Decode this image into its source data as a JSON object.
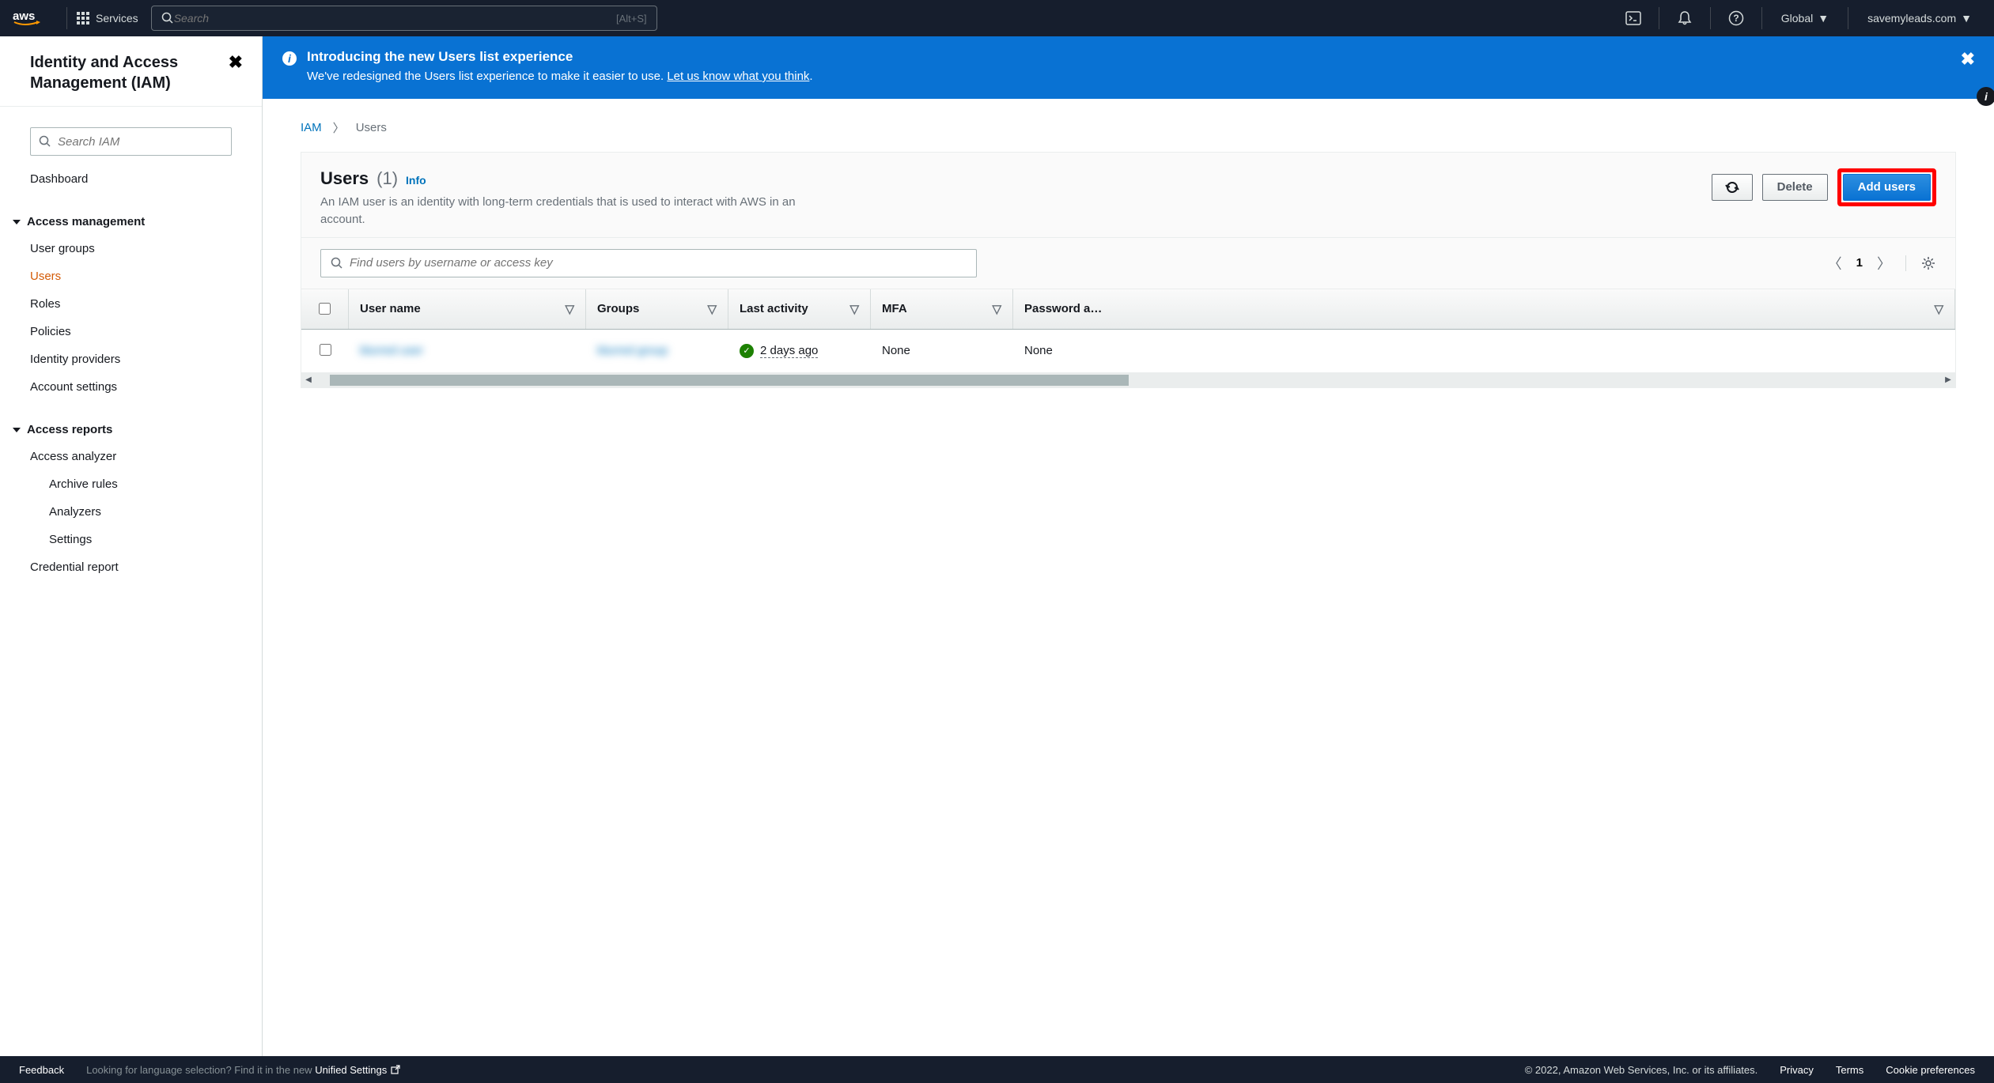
{
  "topnav": {
    "services_label": "Services",
    "search_placeholder": "Search",
    "search_shortcut": "[Alt+S]",
    "region": "Global",
    "account": "savemyleads.com"
  },
  "sidebar": {
    "title": "Identity and Access Management (IAM)",
    "search_placeholder": "Search IAM",
    "dashboard": "Dashboard",
    "section_access_mgmt": "Access management",
    "items_access": [
      "User groups",
      "Users",
      "Roles",
      "Policies",
      "Identity providers",
      "Account settings"
    ],
    "section_reports": "Access reports",
    "access_analyzer": "Access analyzer",
    "analyzer_sub": [
      "Archive rules",
      "Analyzers",
      "Settings"
    ],
    "credential_report": "Credential report"
  },
  "banner": {
    "title": "Introducing the new Users list experience",
    "text": "We've redesigned the Users list experience to make it easier to use. ",
    "link": "Let us know what you think"
  },
  "breadcrumb": {
    "root": "IAM",
    "current": "Users"
  },
  "panel": {
    "title": "Users",
    "count": "(1)",
    "info": "Info",
    "description": "An IAM user is an identity with long-term credentials that is used to interact with AWS in an account.",
    "btn_delete": "Delete",
    "btn_add": "Add users",
    "search_placeholder": "Find users by username or access key",
    "page": "1"
  },
  "table": {
    "columns": {
      "user": "User name",
      "groups": "Groups",
      "activity": "Last activity",
      "mfa": "MFA",
      "password": "Password a…"
    },
    "rows": [
      {
        "user": "blurred user",
        "groups": "blurred group",
        "activity": "2 days ago",
        "mfa": "None",
        "password": "None"
      }
    ]
  },
  "footer": {
    "feedback": "Feedback",
    "lang_text": "Looking for language selection? Find it in the new ",
    "unified": "Unified Settings",
    "copyright": "© 2022, Amazon Web Services, Inc. or its affiliates.",
    "privacy": "Privacy",
    "terms": "Terms",
    "cookies": "Cookie preferences"
  }
}
